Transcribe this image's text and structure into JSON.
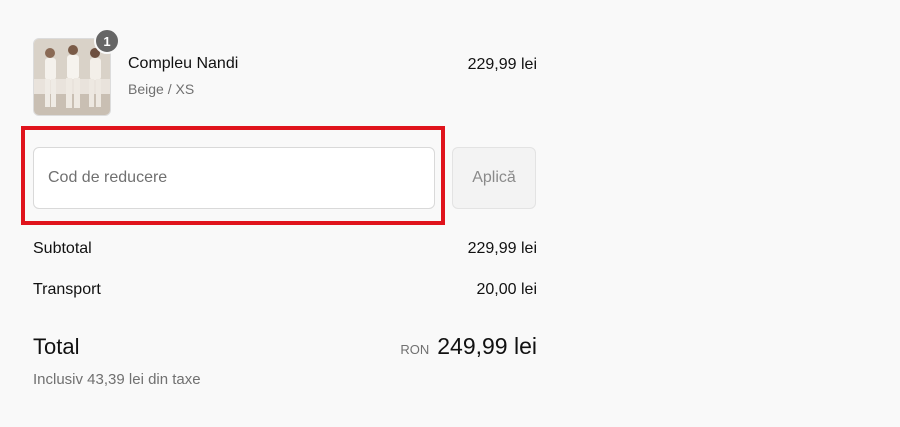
{
  "product": {
    "name": "Compleu Nandi",
    "variant": "Beige / XS",
    "price": "229,99 lei",
    "quantity": "1",
    "image_icon": "product-photo-icon"
  },
  "discount": {
    "placeholder": "Cod de reducere",
    "value": "",
    "apply_label": "Aplică"
  },
  "summary": {
    "subtotal_label": "Subtotal",
    "subtotal_value": "229,99 lei",
    "shipping_label": "Transport",
    "shipping_value": "20,00 lei",
    "total_label": "Total",
    "currency": "RON",
    "total_value": "249,99 lei",
    "taxes_note": "Inclusiv 43,39 lei din taxe"
  },
  "colors": {
    "highlight": "#e0131c",
    "background": "#f9f9f9",
    "muted_text": "#707070"
  }
}
